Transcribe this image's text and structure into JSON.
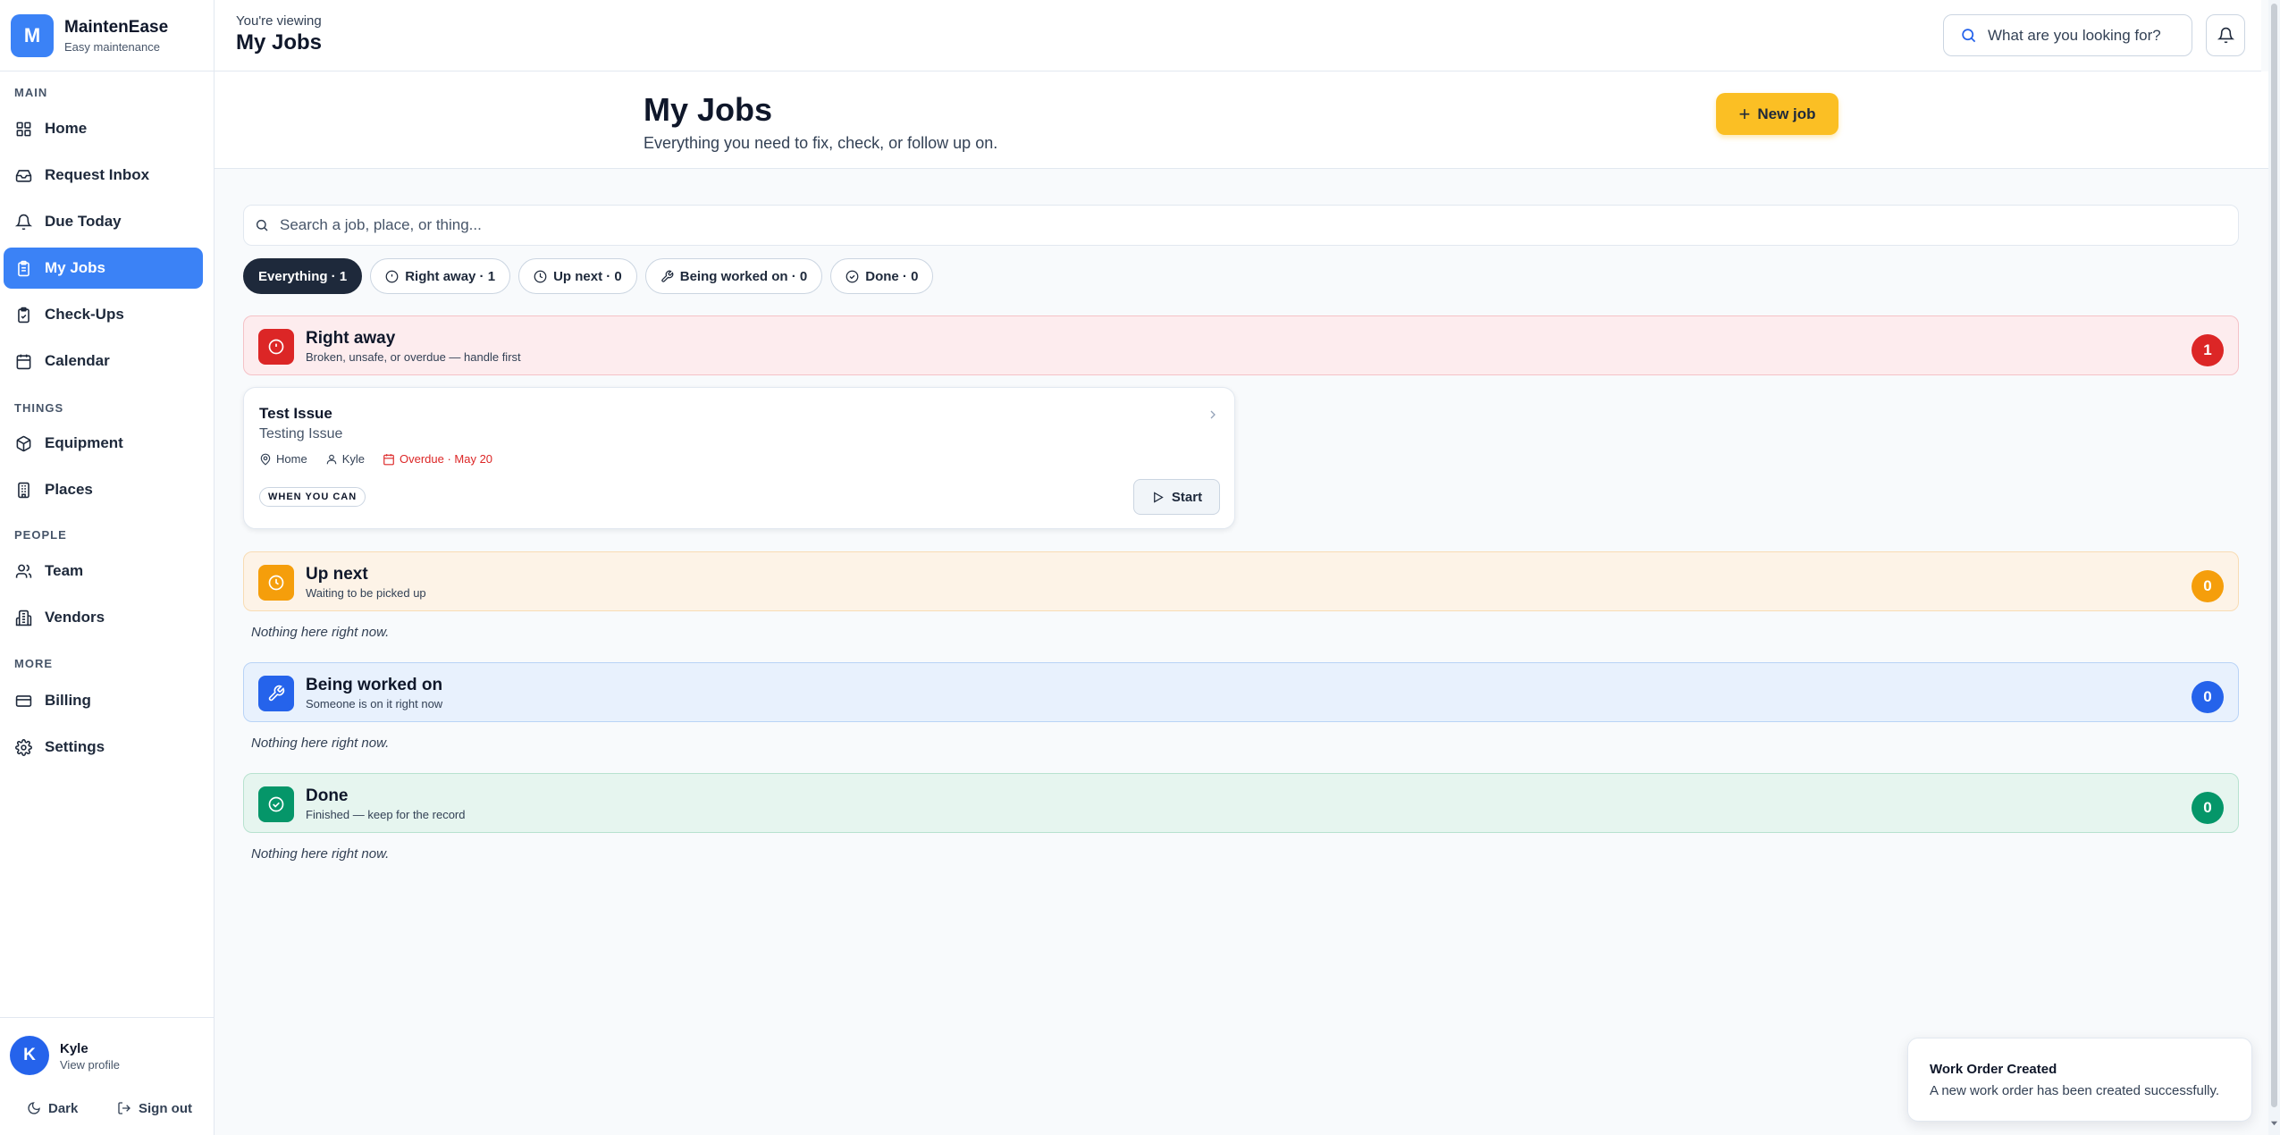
{
  "app": {
    "logo_letter": "M",
    "name": "MaintenEase",
    "tagline": "Easy maintenance"
  },
  "sidebar": {
    "sections": {
      "main": "MAIN",
      "things": "THINGS",
      "people": "PEOPLE",
      "more": "MORE"
    },
    "items": [
      {
        "label": "Home",
        "icon": "grid-icon"
      },
      {
        "label": "Request Inbox",
        "icon": "inbox-icon"
      },
      {
        "label": "Due Today",
        "icon": "bell-icon"
      },
      {
        "label": "My Jobs",
        "icon": "clipboard-icon",
        "active": true
      },
      {
        "label": "Check-Ups",
        "icon": "clipboard-check-icon"
      },
      {
        "label": "Calendar",
        "icon": "calendar-icon"
      },
      {
        "label": "Equipment",
        "icon": "box-icon"
      },
      {
        "label": "Places",
        "icon": "building-icon"
      },
      {
        "label": "Team",
        "icon": "users-icon"
      },
      {
        "label": "Vendors",
        "icon": "office-icon"
      },
      {
        "label": "Billing",
        "icon": "credit-card-icon"
      },
      {
        "label": "Settings",
        "icon": "gear-icon"
      }
    ],
    "user": {
      "initial": "K",
      "name": "Kyle",
      "link": "View profile"
    },
    "footer": {
      "dark_label": "Dark",
      "signout_label": "Sign out"
    }
  },
  "topbar": {
    "viewing_label": "You're viewing",
    "title": "My Jobs",
    "search_placeholder": "What are you looking for?"
  },
  "page": {
    "title": "My Jobs",
    "subtitle": "Everything you need to fix, check, or follow up on.",
    "new_job_label": "New job",
    "search_placeholder": "Search a job, place, or thing..."
  },
  "filters": [
    {
      "label": "Everything · 1",
      "active": true
    },
    {
      "label": "Right away · 1",
      "icon": "alert-circle-icon"
    },
    {
      "label": "Up next · 0",
      "icon": "clock-icon"
    },
    {
      "label": "Being worked on · 0",
      "icon": "wrench-icon"
    },
    {
      "label": "Done · 0",
      "icon": "check-circle-icon"
    }
  ],
  "groups": {
    "right_away": {
      "title": "Right away",
      "subtitle": "Broken, unsafe, or overdue — handle first",
      "count": "1",
      "color": "#dc2626"
    },
    "up_next": {
      "title": "Up next",
      "subtitle": "Waiting to be picked up",
      "count": "0",
      "color": "#f59e0b"
    },
    "in_progress": {
      "title": "Being worked on",
      "subtitle": "Someone is on it right now",
      "count": "0",
      "color": "#2563eb"
    },
    "done": {
      "title": "Done",
      "subtitle": "Finished — keep for the record",
      "count": "0",
      "color": "#059669"
    }
  },
  "empty_text": "Nothing here right now.",
  "job": {
    "title": "Test Issue",
    "description": "Testing Issue",
    "location": "Home",
    "assignee": "Kyle",
    "due": "Overdue · May 20",
    "priority": "WHEN YOU CAN",
    "start_label": "Start"
  },
  "toast": {
    "title": "Work Order Created",
    "message": "A new work order has been created successfully."
  }
}
